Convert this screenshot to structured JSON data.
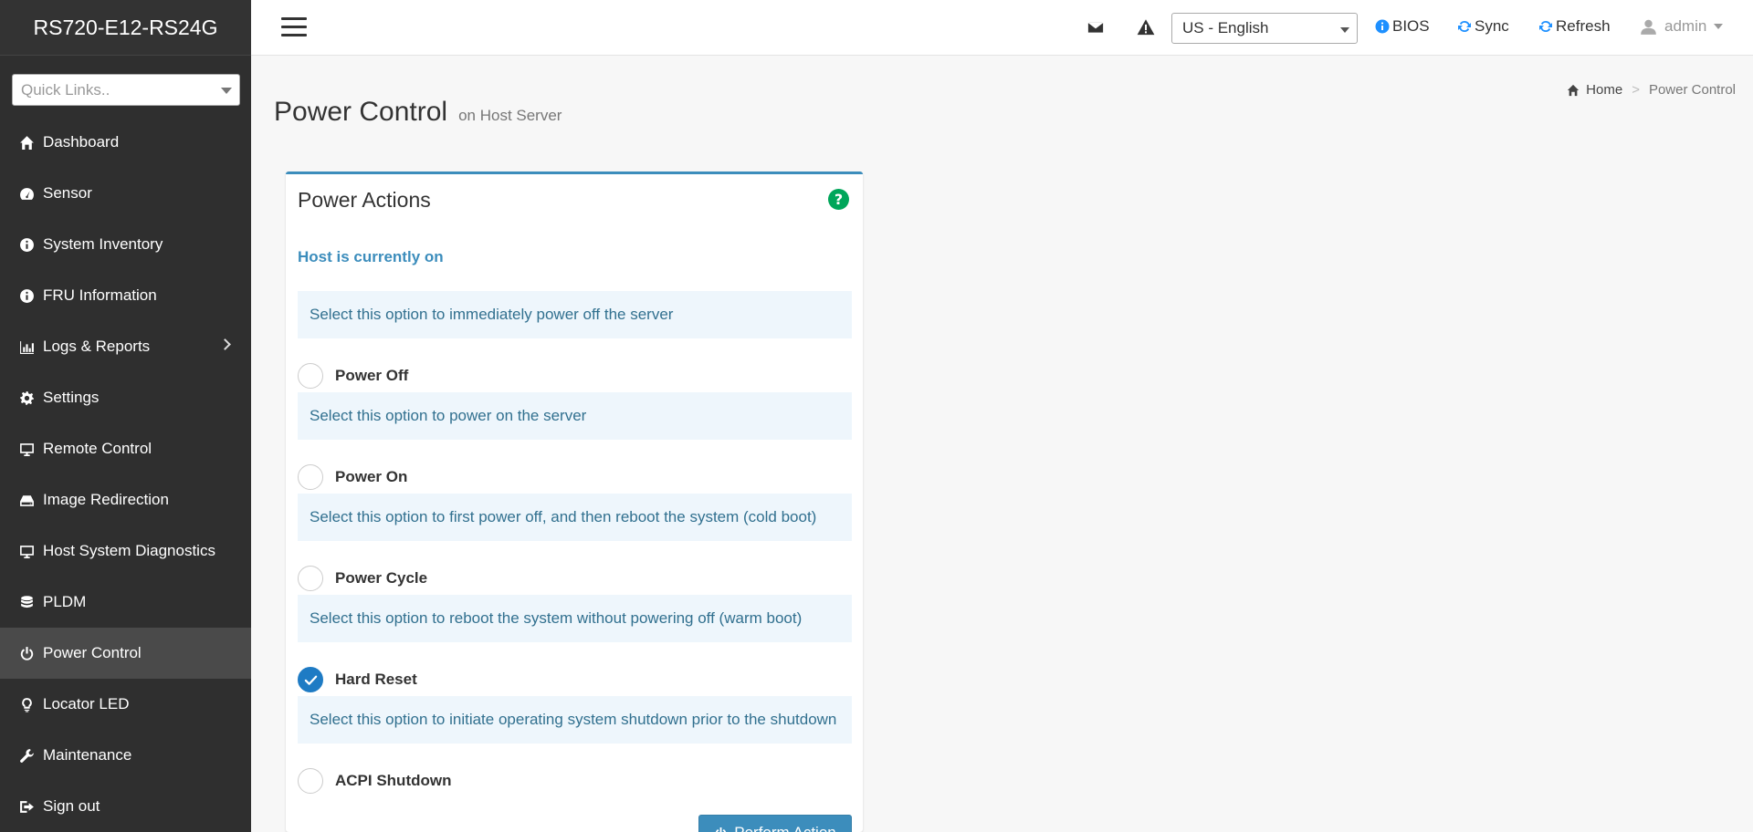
{
  "brand": "RS720-E12-RS24G",
  "quick_links": {
    "placeholder": "Quick Links.."
  },
  "sidebar": {
    "items": [
      {
        "label": "Dashboard",
        "icon": "home-icon"
      },
      {
        "label": "Sensor",
        "icon": "gauge-icon"
      },
      {
        "label": "System Inventory",
        "icon": "info-icon"
      },
      {
        "label": "FRU Information",
        "icon": "info-icon"
      },
      {
        "label": "Logs & Reports",
        "icon": "bar-chart-icon",
        "has_submenu": true
      },
      {
        "label": "Settings",
        "icon": "gear-icon"
      },
      {
        "label": "Remote Control",
        "icon": "monitor-icon"
      },
      {
        "label": "Image Redirection",
        "icon": "drive-icon"
      },
      {
        "label": "Host System Diagnostics",
        "icon": "monitor-icon"
      },
      {
        "label": "PLDM",
        "icon": "database-icon"
      },
      {
        "label": "Power Control",
        "icon": "power-icon",
        "active": true
      },
      {
        "label": "Locator LED",
        "icon": "lightbulb-icon"
      },
      {
        "label": "Maintenance",
        "icon": "wrench-icon"
      },
      {
        "label": "Sign out",
        "icon": "sign-out-icon"
      }
    ]
  },
  "topbar": {
    "language": "US - English",
    "bios_label": "BIOS",
    "sync_label": "Sync",
    "refresh_label": "Refresh",
    "user_label": "admin"
  },
  "page": {
    "title": "Power Control",
    "subtitle": "on Host Server"
  },
  "breadcrumb": {
    "home": "Home",
    "current": "Power Control"
  },
  "panel": {
    "title": "Power Actions",
    "status": "Host is currently on",
    "options": [
      {
        "description": "Select this option to immediately power off the server",
        "label": "Power Off",
        "checked": false
      },
      {
        "description": "Select this option to power on the server",
        "label": "Power On",
        "checked": false
      },
      {
        "description": "Select this option to first power off, and then reboot the system (cold boot)",
        "label": "Power Cycle",
        "checked": false
      },
      {
        "description": "Select this option to reboot the system without powering off (warm boot)",
        "label": "Hard Reset",
        "checked": true
      },
      {
        "description": "Select this option to initiate operating system shutdown prior to the shutdown",
        "label": "ACPI Shutdown",
        "checked": false
      }
    ],
    "action_button": "Perform Action"
  },
  "colors": {
    "sidebar_bg": "#2f2f2f",
    "accent": "#3c8dbc",
    "radio_checked": "#1e7bc4",
    "desc_bg": "#eef6fc",
    "help": "#00a65a"
  }
}
